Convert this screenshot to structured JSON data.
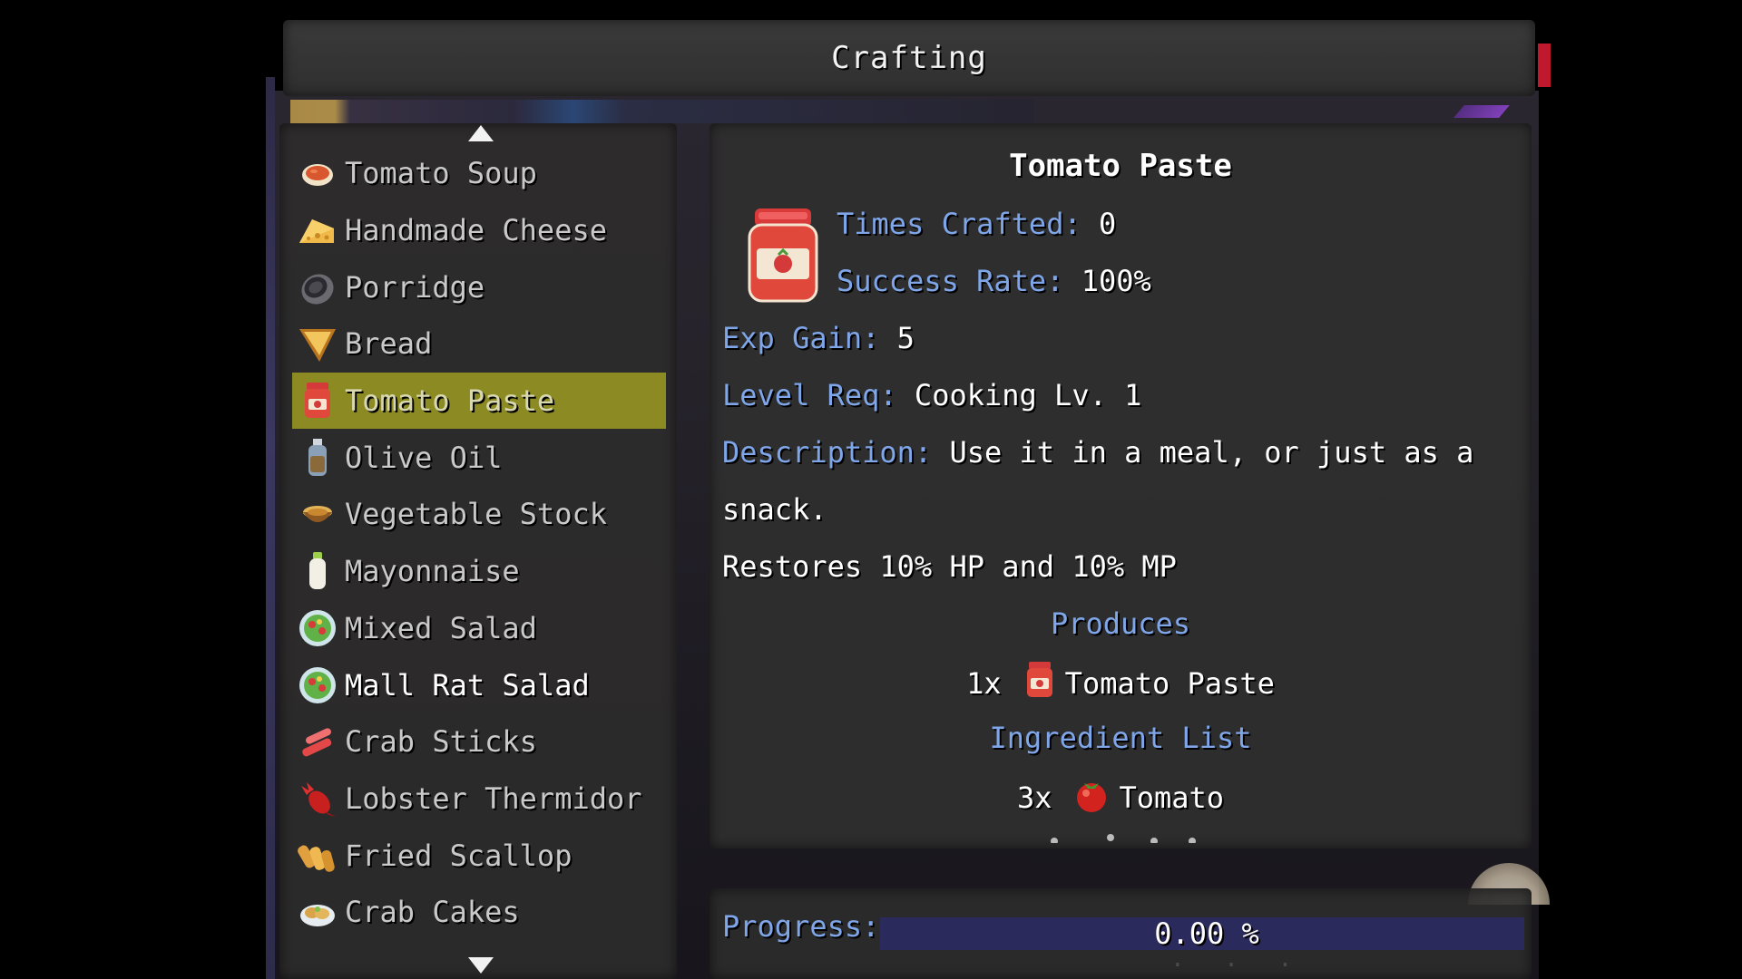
{
  "window": {
    "title": "Crafting"
  },
  "recipes": [
    {
      "label": "Tomato Soup",
      "icon": "soup-bowl-icon"
    },
    {
      "label": "Handmade Cheese",
      "icon": "cheese-wedge-icon"
    },
    {
      "label": "Porridge",
      "icon": "porridge-bowl-icon"
    },
    {
      "label": "Bread",
      "icon": "bread-slice-icon"
    },
    {
      "label": "Tomato Paste",
      "icon": "jar-icon"
    },
    {
      "label": "Olive Oil",
      "icon": "oil-bottle-icon"
    },
    {
      "label": "Vegetable Stock",
      "icon": "stock-bowl-icon"
    },
    {
      "label": "Mayonnaise",
      "icon": "mayo-bottle-icon"
    },
    {
      "label": "Mixed Salad",
      "icon": "salad-plate-icon"
    },
    {
      "label": "Mall Rat Salad",
      "icon": "salad-plate-icon"
    },
    {
      "label": "Crab Sticks",
      "icon": "crab-sticks-icon"
    },
    {
      "label": "Lobster Thermidor",
      "icon": "lobster-icon"
    },
    {
      "label": "Fried Scallop",
      "icon": "fried-scallop-icon"
    },
    {
      "label": "Crab Cakes",
      "icon": "crab-cakes-icon"
    }
  ],
  "detail": {
    "title": "Tomato Paste",
    "times_crafted_key": "Times Crafted:",
    "times_crafted_value": "0",
    "success_rate_key": "Success Rate:",
    "success_rate_value": "100%",
    "exp_gain_key": "Exp Gain:",
    "exp_gain_value": "5",
    "level_req_key": "Level Req:",
    "level_req_value": "Cooking Lv. 1",
    "description_key": "Description:",
    "description_line1": "Use it in a meal, or just as a",
    "description_line2": "snack.",
    "restores": "Restores 10% HP and 10% MP",
    "produces_heading": "Produces",
    "produces_qty": "1x",
    "produces_item": "Tomato Paste",
    "ingredients_heading": "Ingredient List",
    "ingredient_qty": "3x",
    "ingredient_item": "Tomato"
  },
  "progress": {
    "label": "Progress:",
    "value_text": "0.00 %",
    "fraction": 0.0
  },
  "colors": {
    "selection": "#8c8a22",
    "key_blue": "#7fa6e8",
    "progress_track": "#2b2a5c"
  }
}
